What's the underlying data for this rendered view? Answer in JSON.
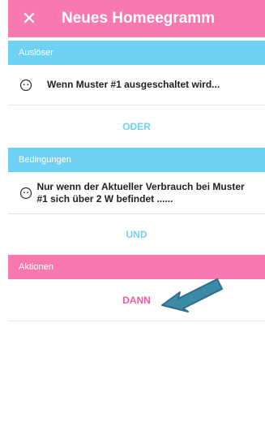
{
  "header": {
    "close_symbol": "✕",
    "title": "Neues Homeegramm"
  },
  "triggers": {
    "label": "Auslöser",
    "item": {
      "icon": "smiley-face-icon",
      "text": "Wenn Muster #1 ausgeschaltet wird..."
    },
    "or_label": "ODER"
  },
  "conditions": {
    "label": "Bedingungen",
    "item": {
      "icon": "smiley-face-icon",
      "text": "Nur wenn der Aktueller Verbrauch bei Muster #1 sich über 2 W befindet ......"
    },
    "and_label": "UND"
  },
  "actions": {
    "label": "Aktionen",
    "then_label": "DANN"
  },
  "colors": {
    "header": "#f878b0",
    "blue": "#6fd2f3",
    "pink": "#f878b0",
    "arrow": "#3d8aa8"
  }
}
